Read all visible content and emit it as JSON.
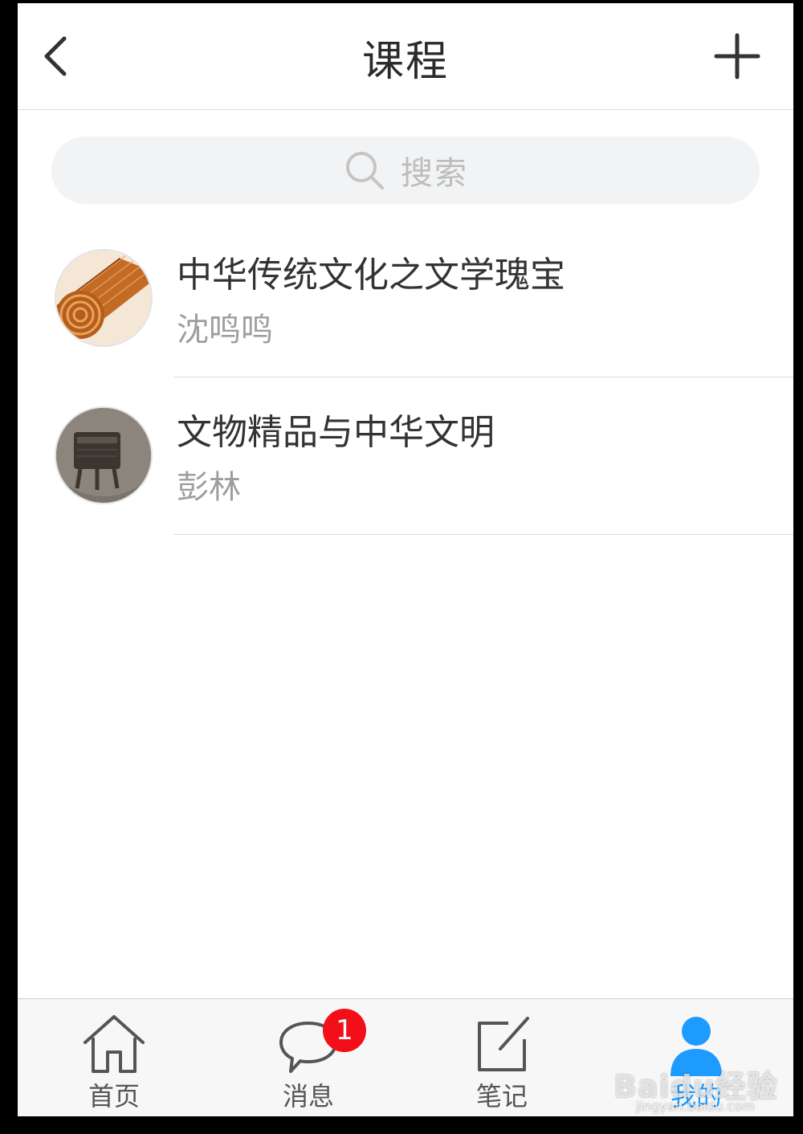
{
  "header": {
    "title": "课程"
  },
  "search": {
    "placeholder": "搜索"
  },
  "courses": [
    {
      "title": "中华传统文化之文学瑰宝",
      "teacher": "沈鸣鸣"
    },
    {
      "title": "文物精品与中华文明",
      "teacher": "彭林"
    }
  ],
  "tabbar": {
    "items": [
      {
        "label": "首页",
        "icon": "home-icon"
      },
      {
        "label": "消息",
        "icon": "chat-bubble-icon",
        "badge": "1"
      },
      {
        "label": "笔记",
        "icon": "edit-note-icon"
      },
      {
        "label": "我的",
        "icon": "user-icon",
        "active": true
      }
    ]
  },
  "colors": {
    "accent": "#1e9bff",
    "badge": "#f20f19",
    "background": "#ffffff",
    "search_bg": "#f2f3f5"
  },
  "watermark": {
    "text": "Baidu经验",
    "url_text": "jingyan.baidu.com"
  }
}
